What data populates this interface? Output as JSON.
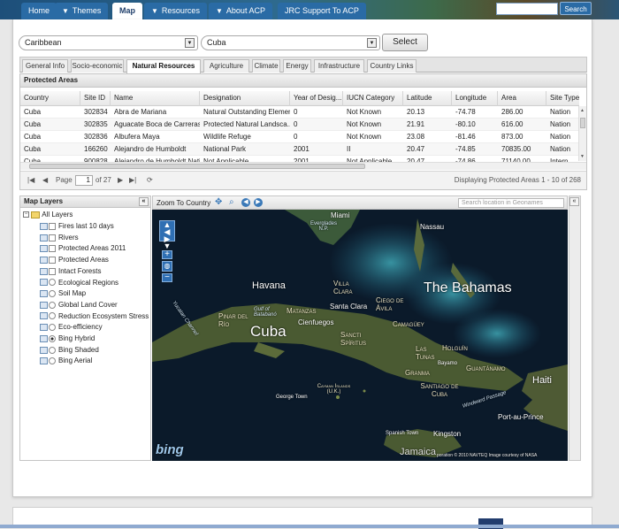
{
  "nav": {
    "items": [
      {
        "label": "Home",
        "dropdown": false,
        "active": false
      },
      {
        "label": "Themes",
        "dropdown": true,
        "active": false
      },
      {
        "label": "Map",
        "dropdown": false,
        "active": true
      },
      {
        "label": "Resources",
        "dropdown": true,
        "active": false
      },
      {
        "label": "About ACP",
        "dropdown": true,
        "active": false
      },
      {
        "label": "JRC Support To ACP",
        "dropdown": false,
        "active": false
      }
    ],
    "search_button": "Search"
  },
  "selectors": {
    "region": "Caribbean",
    "country": "Cuba",
    "select_button": "Select"
  },
  "tabs": [
    "General Info",
    "Socio-economic",
    "Natural Resources",
    "Agriculture",
    "Climate",
    "Energy",
    "Infrastructure",
    "Country Links"
  ],
  "active_tab": "Natural Resources",
  "protected_areas": {
    "title": "Protected Areas",
    "columns": [
      "Country",
      "Site ID",
      "Name",
      "Designation",
      "Year of Desig...",
      "IUCN Category",
      "Latitude",
      "Longitude",
      "Area",
      "Site Type"
    ],
    "rows": [
      [
        "Cuba",
        "302834",
        "Abra de Mariana",
        "Natural Outstanding Element",
        "0",
        "Not Known",
        "20.13",
        "-74.78",
        "286.00",
        "Nation"
      ],
      [
        "Cuba",
        "302835",
        "Aguacate Boca de Carreras",
        "Protected Natural Landsca...",
        "0",
        "Not Known",
        "21.91",
        "-80.10",
        "616.00",
        "Nation"
      ],
      [
        "Cuba",
        "302836",
        "Albufera Maya",
        "Wildlife Refuge",
        "0",
        "Not Known",
        "23.08",
        "-81.46",
        "873.00",
        "Nation"
      ],
      [
        "Cuba",
        "166260",
        "Alejandro de Humboldt",
        "National Park",
        "2001",
        "II",
        "20.47",
        "-74.85",
        "70835.00",
        "Nation"
      ],
      [
        "Cuba",
        "900828",
        "Alejandro de Humboldt Nati...",
        "Not Applicable",
        "2001",
        "Not Applicable",
        "20.47",
        "-74.86",
        "71140.00",
        "Intern"
      ]
    ],
    "pager": {
      "page_label": "Page",
      "page": "1",
      "of_label": "of 27",
      "display_text": "Displaying Protected Areas 1 - 10 of 268"
    }
  },
  "map_layers": {
    "title": "Map Layers",
    "root": "All Layers",
    "items": [
      {
        "label": "Fires last 10 days",
        "control": "check",
        "on": false
      },
      {
        "label": "Rivers",
        "control": "check",
        "on": false
      },
      {
        "label": "Protected Areas 2011",
        "control": "check",
        "on": false
      },
      {
        "label": "Protected Areas",
        "control": "check",
        "on": false
      },
      {
        "label": "Intact Forests",
        "control": "check",
        "on": false
      },
      {
        "label": "Ecological Regions",
        "control": "radio",
        "on": false
      },
      {
        "label": "Soil Map",
        "control": "radio",
        "on": false
      },
      {
        "label": "Global Land Cover",
        "control": "radio",
        "on": false
      },
      {
        "label": "Reduction Ecosystem Stress",
        "control": "radio",
        "on": false
      },
      {
        "label": "Eco-efficiency",
        "control": "radio",
        "on": false
      },
      {
        "label": "Bing Hybrid",
        "control": "radio",
        "on": true
      },
      {
        "label": "Bing Shaded",
        "control": "radio",
        "on": false
      },
      {
        "label": "Bing Aerial",
        "control": "radio",
        "on": false
      }
    ]
  },
  "map": {
    "zoom_to_country": "Zoom To Country",
    "geo_search_placeholder": "Search location in Geonames",
    "labels": {
      "miami": "Miami",
      "everglades": "Everglades N.P.",
      "nassau": "Nassau",
      "bahamas": "The Bahamas",
      "havana": "Havana",
      "villa_clara": "Villa Clara",
      "santa_clara": "Santa Clara",
      "ciego": "Ciego de Ávila",
      "gulf": "Gulf of Batabanó",
      "matanzas": "Matanzas",
      "pinar": "Pinar del Río",
      "cuba": "Cuba",
      "cienfuegos": "Cienfuegos",
      "camaguey": "Camagüey",
      "sancti": "Sancti Spíritus",
      "yucatan": "Yucatan Channel",
      "las_tunas": "Las Tunas",
      "holguin": "Holguín",
      "bayamo": "Bayamo",
      "granma": "Granma",
      "guantanamo": "Guantánamo",
      "santiago": "Santiago de Cuba",
      "haiti": "Haiti",
      "windward": "Windward Passage",
      "port": "Port-au-Prince",
      "george": "George Town",
      "cayman": "Cayman Islands (U.K.)",
      "spanish": "Spanish Town",
      "kingston": "Kingston",
      "jamaica": "Jamaica",
      "bing": "bing",
      "copyright": "poration   © 2010 NAVTEQ   Image courtesy of NASA"
    }
  },
  "colors": {
    "nav_blue": "#2a6ba5",
    "map_water": "#0d1b2b",
    "land": "#4a5a32"
  }
}
